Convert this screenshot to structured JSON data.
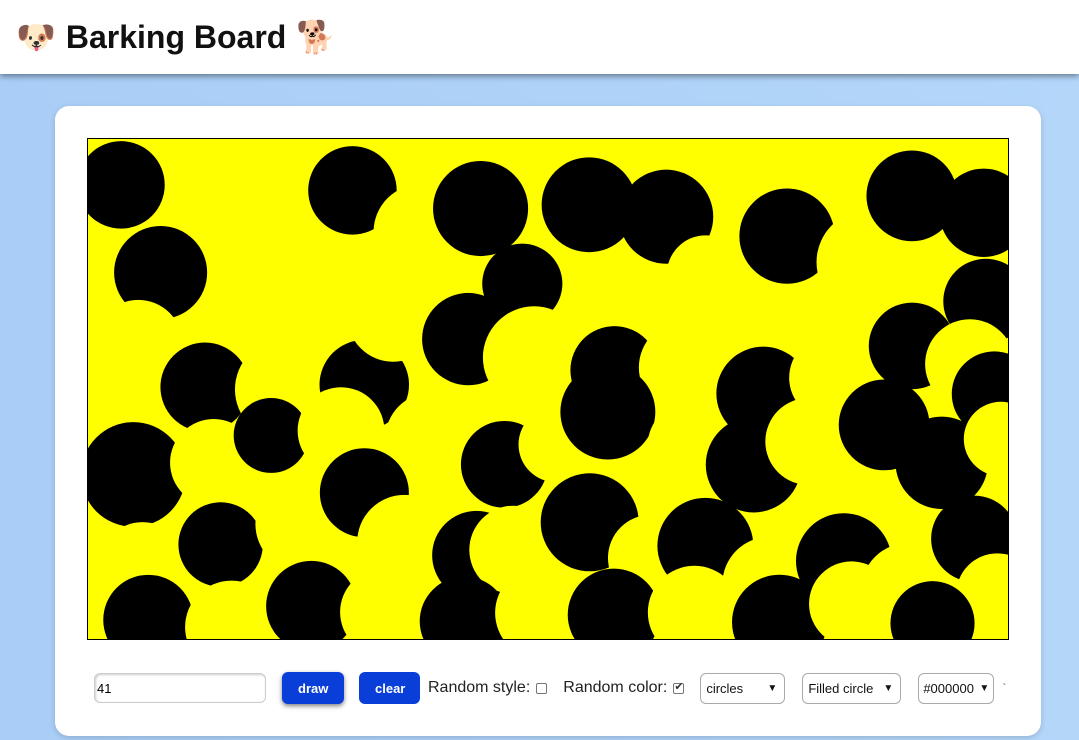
{
  "header": {
    "title": "Barking Board",
    "left_emoji": "🐶",
    "right_emoji": "🐕",
    "left_icon": "dog-face-icon",
    "right_icon": "dog-icon"
  },
  "board": {
    "background": "#ffff00",
    "fill_color": "#000000",
    "shape": "circles"
  },
  "controls": {
    "count_value": "41",
    "draw_label": "draw",
    "clear_label": "clear",
    "random_style_label": "Random style:",
    "random_style_checked": false,
    "random_color_label": "Random color:",
    "random_color_checked": true,
    "shape_select": "circles",
    "style_select": "Filled circle",
    "color_select": "#000000",
    "trailing_mark": "`"
  },
  "colors": {
    "accent": "#0a3ed8",
    "background": "#aed1f7"
  }
}
